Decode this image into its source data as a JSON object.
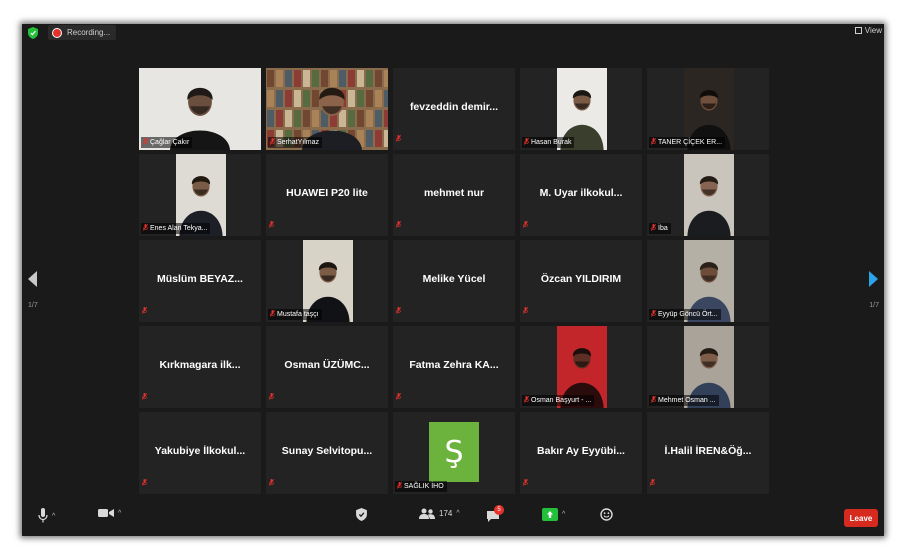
{
  "topbar": {
    "recording_label": "Recording...",
    "view_label": "View"
  },
  "pagination": {
    "left": "1/7",
    "right": "1/7"
  },
  "participants": [
    {
      "name": "Çağlar Çakır",
      "display": "video",
      "row": 0,
      "col": 0
    },
    {
      "name": "SerhatYılmaz",
      "display": "video",
      "row": 0,
      "col": 1,
      "active": true
    },
    {
      "name": "fevzeddin demir...",
      "display": "name",
      "row": 0,
      "col": 2
    },
    {
      "name": "Hasan Burak",
      "display": "video",
      "row": 0,
      "col": 3
    },
    {
      "name": "TANER ÇİÇEK ER...",
      "display": "video",
      "row": 0,
      "col": 4
    },
    {
      "name": "Enes Alan Tekya...",
      "display": "video",
      "row": 1,
      "col": 0
    },
    {
      "name": "HUAWEI P20 lite",
      "display": "name",
      "row": 1,
      "col": 1
    },
    {
      "name": "mehmet nur",
      "display": "name",
      "row": 1,
      "col": 2
    },
    {
      "name": "M. Uyar ilkokul...",
      "display": "name",
      "row": 1,
      "col": 3
    },
    {
      "name": "İba",
      "display": "video",
      "row": 1,
      "col": 4
    },
    {
      "name": "Müslüm BEYAZ...",
      "display": "name",
      "row": 2,
      "col": 0
    },
    {
      "name": "Mustafa taşçı",
      "display": "video",
      "row": 2,
      "col": 1
    },
    {
      "name": "Melike Yücel",
      "display": "name",
      "row": 2,
      "col": 2
    },
    {
      "name": "Özcan YILDIRIM",
      "display": "name",
      "row": 2,
      "col": 3
    },
    {
      "name": "Eyyüp Göncü Ört...",
      "display": "video",
      "row": 2,
      "col": 4
    },
    {
      "name": "Kırkmagara ilk...",
      "display": "name",
      "row": 3,
      "col": 0
    },
    {
      "name": "Osman ÜZÜMC...",
      "display": "name",
      "row": 3,
      "col": 1
    },
    {
      "name": "Fatma Zehra KA...",
      "display": "name",
      "row": 3,
      "col": 2
    },
    {
      "name": "Osman Başyurt - ...",
      "display": "video",
      "row": 3,
      "col": 3
    },
    {
      "name": "Mehmet Osman ...",
      "display": "video",
      "row": 3,
      "col": 4
    },
    {
      "name": "Yakubiye İlkokul...",
      "display": "name",
      "row": 4,
      "col": 0
    },
    {
      "name": "Sunay Selvitopu...",
      "display": "name",
      "row": 4,
      "col": 1
    },
    {
      "name": "SAĞLIK İHO",
      "display": "logo",
      "logo_text": "Ş",
      "row": 4,
      "col": 2
    },
    {
      "name": "Bakır Ay Eyyübi...",
      "display": "name",
      "row": 4,
      "col": 3
    },
    {
      "name": "İ.Halil İREN&Öğ...",
      "display": "name",
      "row": 4,
      "col": 4
    }
  ],
  "toolbar": {
    "participants_count": "174",
    "chat_badge": "5",
    "leave_label": "Leave"
  },
  "colors": {
    "background": "#1a1a1a",
    "tile": "#232323",
    "active_speaker": "#b7d43a",
    "muted_mic": "#e5322d",
    "leave": "#d62a1f",
    "share": "#23c13a",
    "next_arrow": "#2ba3e8"
  }
}
